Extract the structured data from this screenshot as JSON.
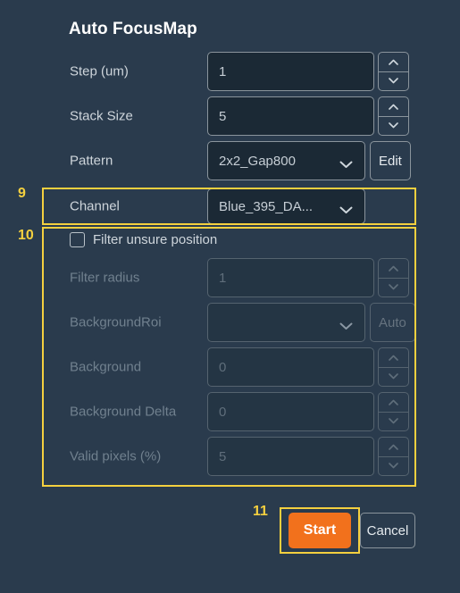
{
  "dialog": {
    "title": "Auto FocusMap"
  },
  "fields": {
    "step": {
      "label": "Step (um)",
      "value": "1"
    },
    "stack_size": {
      "label": "Stack Size",
      "value": "5"
    },
    "pattern": {
      "label": "Pattern",
      "value": "2x2_Gap800",
      "edit_label": "Edit"
    },
    "channel": {
      "label": "Channel",
      "value": "Blue_395_DA..."
    }
  },
  "filter_section": {
    "checkbox_label": "Filter unsure position",
    "checked": false,
    "filter_radius": {
      "label": "Filter radius",
      "value": "1"
    },
    "background_roi": {
      "label": "BackgroundRoi",
      "value": "",
      "auto_label": "Auto"
    },
    "background": {
      "label": "Background",
      "value": "0"
    },
    "background_delta": {
      "label": "Background Delta",
      "value": "0"
    },
    "valid_pixels": {
      "label": "Valid pixels (%)",
      "value": "5"
    }
  },
  "footer": {
    "start_label": "Start",
    "cancel_label": "Cancel"
  },
  "annotations": {
    "a9": "9",
    "a10": "10",
    "a11": "11"
  },
  "colors": {
    "background": "#2a3b4d",
    "input_background": "#1b2935",
    "accent_start": "#f2711c",
    "highlight": "#f4d03f",
    "text": "#ced5db",
    "text_disabled": "#6f7e8c"
  }
}
